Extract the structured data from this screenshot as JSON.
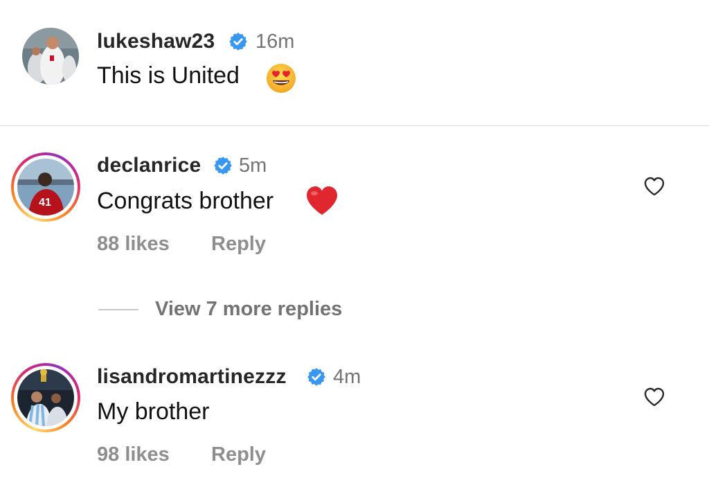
{
  "caption": {
    "username": "lukeshaw23",
    "time": "16m",
    "text": "This is United",
    "emoji": "heart-eyes-emoji"
  },
  "comments": [
    {
      "username": "declanrice",
      "time": "5m",
      "text": "Congrats brother",
      "emoji": "red-heart-emoji",
      "likes": "88 likes",
      "reply": "Reply"
    },
    {
      "username": "lisandromartinezzz",
      "time": "4m",
      "text": "My brother",
      "likes": "98 likes",
      "reply": "Reply"
    }
  ],
  "thread": {
    "view_more": "View 7 more replies"
  },
  "colors": {
    "verified": "#3897f0",
    "muted": "#8e8e8e",
    "divider": "#dbdbdb",
    "heart": "#e0262f"
  }
}
